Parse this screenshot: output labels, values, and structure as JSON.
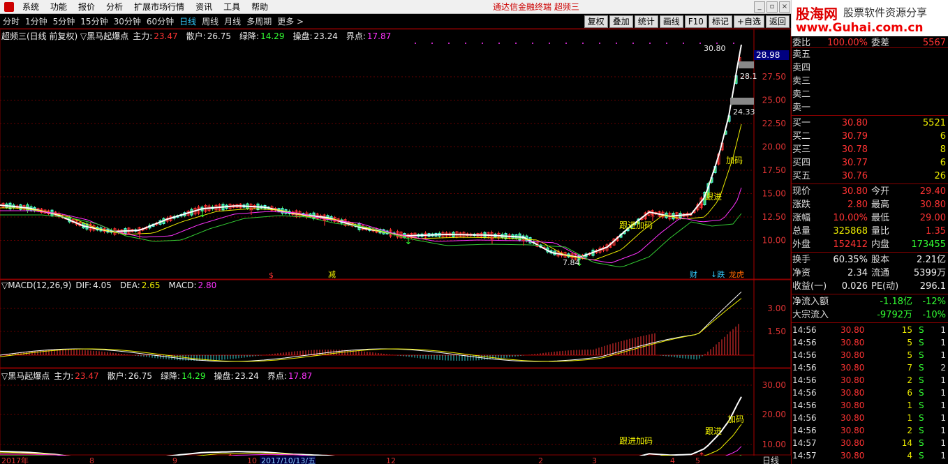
{
  "menu": [
    "系统",
    "功能",
    "报价",
    "分析",
    "扩展市场行情",
    "资讯",
    "工具",
    "帮助"
  ],
  "app_title": "通达信金融终端  超频三",
  "logo": {
    "name": "股海网",
    "slogan": "股票软件资源分享",
    "url": "www.Guhai.com.cn"
  },
  "periods": [
    "分时",
    "1分钟",
    "5分钟",
    "15分钟",
    "30分钟",
    "60分钟",
    "日线",
    "周线",
    "月线",
    "多周期",
    "更多 >"
  ],
  "active_period": "日线",
  "right_tools": [
    "复权",
    "叠加",
    "统计",
    "画线",
    "F10",
    "标记",
    "+自选",
    "返回"
  ],
  "main_legend": {
    "title": "超频三(日线 前复权) ▽黑马起爆点",
    "items": [
      {
        "label": "主力:",
        "value": "23.47",
        "color": "#ff3333"
      },
      {
        "label": "散户:",
        "value": "26.75",
        "color": "#eeeeee"
      },
      {
        "label": "绿降:",
        "value": "14.29",
        "color": "#33ff33"
      },
      {
        "label": "操盘:",
        "value": "23.24",
        "color": "#eeeeee"
      },
      {
        "label": "界点:",
        "value": "17.87",
        "color": "#ff33ff"
      }
    ]
  },
  "main_axis": [
    "27.50",
    "25.00",
    "22.50",
    "20.00",
    "17.50",
    "15.00",
    "12.50",
    "10.00"
  ],
  "price_tags": {
    "current": "28.98",
    "high": "30.80",
    "mark1": "28.1",
    "mark2": "24.33",
    "low": "7.84"
  },
  "main_labels": [
    "跟进",
    "加码",
    "跟进加码"
  ],
  "event_labels": [
    "$",
    "减",
    "财",
    "↓跌",
    "龙虎"
  ],
  "macd_legend": {
    "title": "▽MACD(12,26,9)",
    "items": [
      {
        "label": "DIF:",
        "value": "4.05",
        "color": "#eeeeee"
      },
      {
        "label": "DEA:",
        "value": "2.65",
        "color": "#eeee00"
      },
      {
        "label": "MACD:",
        "value": "2.80",
        "color": "#ff33ff"
      }
    ]
  },
  "macd_axis": [
    "3.00",
    "1.50"
  ],
  "sub_legend": {
    "title": "▽黑马起爆点",
    "items": [
      {
        "label": "主力:",
        "value": "23.47",
        "color": "#ff3333"
      },
      {
        "label": "散户:",
        "value": "26.75",
        "color": "#eeeeee"
      },
      {
        "label": "绿降:",
        "value": "14.29",
        "color": "#33ff33"
      },
      {
        "label": "操盘:",
        "value": "23.24",
        "color": "#eeeeee"
      },
      {
        "label": "界点:",
        "value": "17.87",
        "color": "#ff33ff"
      }
    ]
  },
  "sub_axis": [
    "30.00",
    "20.00",
    "10.00"
  ],
  "sub_labels": [
    "跟进",
    "加码",
    "跟进加码"
  ],
  "date_axis": [
    "2017年",
    "8",
    "9",
    "10",
    "2017/10/13/五",
    "12",
    "2",
    "3",
    "4",
    "5"
  ],
  "corner_label": "日线",
  "panel": {
    "top_row": {
      "label": "委比",
      "value": "100.00%",
      "label2": "委差",
      "value2": "5567"
    },
    "sell": [
      {
        "label": "卖五",
        "price": "",
        "vol": ""
      },
      {
        "label": "卖四",
        "price": "",
        "vol": ""
      },
      {
        "label": "卖三",
        "price": "",
        "vol": ""
      },
      {
        "label": "卖二",
        "price": "",
        "vol": ""
      },
      {
        "label": "卖一",
        "price": "",
        "vol": ""
      }
    ],
    "buy": [
      {
        "label": "买一",
        "price": "30.80",
        "vol": "5521"
      },
      {
        "label": "买二",
        "price": "30.79",
        "vol": "6"
      },
      {
        "label": "买三",
        "price": "30.78",
        "vol": "8"
      },
      {
        "label": "买四",
        "price": "30.77",
        "vol": "6"
      },
      {
        "label": "买五",
        "price": "30.76",
        "vol": "26"
      }
    ],
    "stats": [
      {
        "l1": "现价",
        "v1": "30.80",
        "c1": "#ff3333",
        "l2": "今开",
        "v2": "29.40",
        "c2": "#ff3333"
      },
      {
        "l1": "涨跌",
        "v1": "2.80",
        "c1": "#ff3333",
        "l2": "最高",
        "v2": "30.80",
        "c2": "#ff3333"
      },
      {
        "l1": "涨幅",
        "v1": "10.00%",
        "c1": "#ff3333",
        "l2": "最低",
        "v2": "29.00",
        "c2": "#ff3333"
      },
      {
        "l1": "总量",
        "v1": "325868",
        "c1": "#eeee00",
        "l2": "量比",
        "v2": "1.35",
        "c2": "#ff3333"
      },
      {
        "l1": "外盘",
        "v1": "152412",
        "c1": "#ff3333",
        "l2": "内盘",
        "v2": "173455",
        "c2": "#33ff33"
      },
      {
        "l1": "换手",
        "v1": "60.35%",
        "c1": "#eeeeee",
        "l2": "股本",
        "v2": "2.21亿",
        "c2": "#eeeeee"
      },
      {
        "l1": "净资",
        "v1": "2.34",
        "c1": "#eeeeee",
        "l2": "流通",
        "v2": "5399万",
        "c2": "#eeeeee"
      },
      {
        "l1": "收益(一)",
        "v1": "0.026",
        "c1": "#eeeeee",
        "l2": "PE(动)",
        "v2": "296.1",
        "c2": "#eeeeee"
      }
    ],
    "flows": [
      {
        "label": "净流入额",
        "value": "-1.18亿",
        "pct": "-12%"
      },
      {
        "label": "大宗流入",
        "value": "-9792万",
        "pct": "-10%"
      }
    ],
    "ticks": [
      {
        "t": "14:56",
        "p": "30.80",
        "v": "15",
        "s": "S",
        "n": "1"
      },
      {
        "t": "14:56",
        "p": "30.80",
        "v": "5",
        "s": "S",
        "n": "1"
      },
      {
        "t": "14:56",
        "p": "30.80",
        "v": "5",
        "s": "S",
        "n": "1"
      },
      {
        "t": "14:56",
        "p": "30.80",
        "v": "7",
        "s": "S",
        "n": "2"
      },
      {
        "t": "14:56",
        "p": "30.80",
        "v": "2",
        "s": "S",
        "n": "1"
      },
      {
        "t": "14:56",
        "p": "30.80",
        "v": "6",
        "s": "S",
        "n": "1"
      },
      {
        "t": "14:56",
        "p": "30.80",
        "v": "1",
        "s": "S",
        "n": "1"
      },
      {
        "t": "14:56",
        "p": "30.80",
        "v": "1",
        "s": "S",
        "n": "1"
      },
      {
        "t": "14:56",
        "p": "30.80",
        "v": "2",
        "s": "S",
        "n": "1"
      },
      {
        "t": "14:57",
        "p": "30.80",
        "v": "14",
        "s": "S",
        "n": "1"
      },
      {
        "t": "14:57",
        "p": "30.80",
        "v": "4",
        "s": "S",
        "n": "1"
      }
    ]
  }
}
